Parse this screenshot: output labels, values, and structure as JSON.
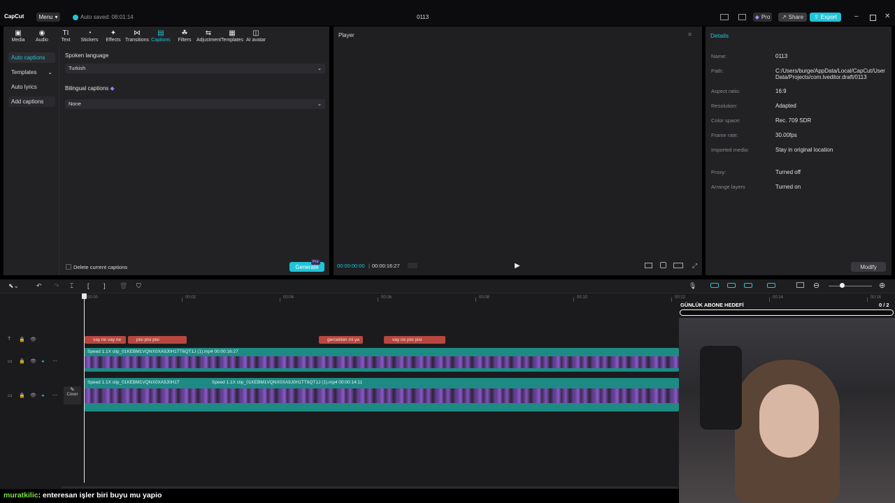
{
  "app": {
    "logo": "CapCut",
    "menu_label": "Menu",
    "autosave": "Auto saved: 08:01:14",
    "project_title": "0113",
    "pro_label": "Pro",
    "share_label": "Share",
    "export_label": "Export"
  },
  "toolbar": {
    "items": [
      {
        "label": "Media",
        "icon": "media-icon"
      },
      {
        "label": "Audio",
        "icon": "audio-icon"
      },
      {
        "label": "Text",
        "icon": "text-icon"
      },
      {
        "label": "Stickers",
        "icon": "stickers-icon"
      },
      {
        "label": "Effects",
        "icon": "effects-icon"
      },
      {
        "label": "Transitions",
        "icon": "transitions-icon"
      },
      {
        "label": "Captions",
        "icon": "captions-icon"
      },
      {
        "label": "Filters",
        "icon": "filters-icon"
      },
      {
        "label": "Adjustment",
        "icon": "adjustment-icon"
      },
      {
        "label": "Templates",
        "icon": "templates-icon"
      },
      {
        "label": "AI avatar",
        "icon": "ai-avatar-icon"
      }
    ]
  },
  "captions_panel": {
    "sidebar": [
      "Auto captions",
      "Templates",
      "Auto lyrics",
      "Add captions"
    ],
    "spoken_language_label": "Spoken language",
    "spoken_language_value": "Turkish",
    "bilingual_label": "Bilingual captions",
    "bilingual_value": "None",
    "delete_label": "Delete current captions",
    "generate_label": "Generate",
    "generate_badge": "Pro"
  },
  "player": {
    "title": "Player",
    "current_time": "00:00:00:00",
    "total_time": "00:00:16:27"
  },
  "details": {
    "title": "Details",
    "rows": [
      {
        "label": "Name:",
        "value": "0113"
      },
      {
        "label": "Path:",
        "value": "C:/Users/burge/AppData/Local/CapCut/User Data/Projects/com.lveditor.draft/0113"
      },
      {
        "label": "Aspect ratio:",
        "value": "16:9"
      },
      {
        "label": "Resolution:",
        "value": "Adapted"
      },
      {
        "label": "Color space:",
        "value": "Rec. 709 SDR"
      },
      {
        "label": "Frame rate:",
        "value": "30.00fps"
      },
      {
        "label": "Imported media:",
        "value": "Stay in original location"
      },
      {
        "label": "Proxy:",
        "value": "Turned off"
      },
      {
        "label": "Arrange layers",
        "value": "Turned on"
      }
    ],
    "modify_label": "Modify"
  },
  "timeline": {
    "ticks": [
      "00:00",
      "00:02",
      "00:04",
      "00:06",
      "00:08",
      "00:10",
      "00:12",
      "00:14",
      "00:16"
    ],
    "caption_clips": [
      "vay ne vay ne",
      "pisi pisi pisi",
      "gercekten mi ya",
      "vay ne pisi pisi"
    ],
    "track1_label": "Speed 1.1X   clip_01KEBM1VQNX0XA9J0H1TT6QT1J (1).mp4   00:00:16:27",
    "track2_label_a": "Speed 1.1X   clip_01KEBM1VQNX0XA9J0H1T",
    "track2_label_b": "Speed 1.1X   clip_01KEBM1VQNX0XA9J0H1TT6QT1J (1).mp4   00:00:14:11",
    "cover_label": "Cover"
  },
  "overlay": {
    "goal_title": "GÜNLÜK ABONE HEDEFİ",
    "goal_count": "0 / 2",
    "goal_progress": 0
  },
  "chat": {
    "user": "muratkilic",
    "message": ": enteresan işler biri buyu mu yapio"
  }
}
